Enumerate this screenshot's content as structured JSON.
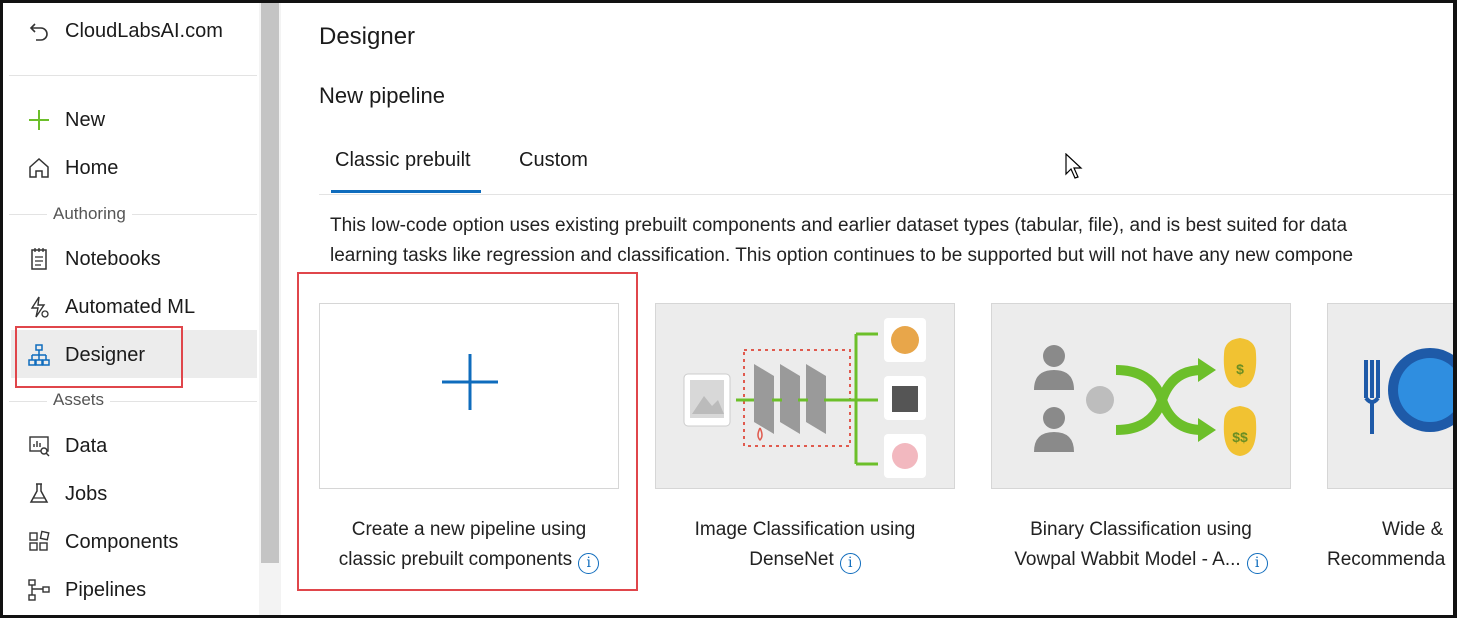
{
  "sidebar": {
    "workspace": "CloudLabsAI.com",
    "items": [
      {
        "label": "New",
        "icon": "plus-icon"
      },
      {
        "label": "Home",
        "icon": "home-icon"
      }
    ],
    "authoring_heading": "Authoring",
    "authoring_items": [
      {
        "label": "Notebooks",
        "icon": "notebook-icon"
      },
      {
        "label": "Automated ML",
        "icon": "automated-ml-icon"
      },
      {
        "label": "Designer",
        "icon": "designer-icon",
        "active": true
      }
    ],
    "assets_heading": "Assets",
    "assets_items": [
      {
        "label": "Data",
        "icon": "data-icon"
      },
      {
        "label": "Jobs",
        "icon": "jobs-flask-icon"
      },
      {
        "label": "Components",
        "icon": "components-icon"
      },
      {
        "label": "Pipelines",
        "icon": "pipelines-icon"
      }
    ]
  },
  "main": {
    "title": "Designer",
    "section_title": "New pipeline",
    "tabs": [
      {
        "label": "Classic prebuilt",
        "selected": true
      },
      {
        "label": "Custom",
        "selected": false
      }
    ],
    "description_line1": "This low-code option uses existing prebuilt components and earlier dataset types (tabular, file), and is best suited for data",
    "description_line2": "learning tasks like regression and classification. This option continues to be supported but will not have any new compone",
    "cards": [
      {
        "title_line1": "Create a new pipeline using",
        "title_line2": "classic prebuilt components"
      },
      {
        "title_line1": "Image Classification using",
        "title_line2": "DenseNet"
      },
      {
        "title_line1": "Binary Classification using",
        "title_line2": "Vowpal Wabbit Model - A..."
      },
      {
        "title_line1": "Wide &",
        "title_line2": "Recommenda"
      }
    ]
  },
  "colors": {
    "accent": "#0f6cbd",
    "highlight_border": "#e0464b",
    "green": "#6cbf2a"
  }
}
